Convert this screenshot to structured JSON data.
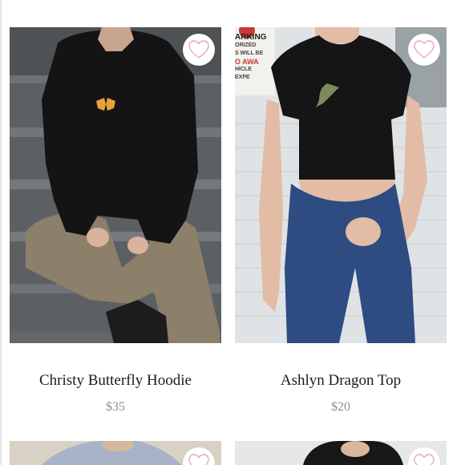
{
  "products": [
    {
      "name": "Christy Butterfly Hoodie",
      "price": "$35"
    },
    {
      "name": "Ashlyn Dragon Top",
      "price": "$20"
    }
  ],
  "partial_products_count_visible": 2,
  "icons": {
    "favorite": "heart-outline-icon"
  },
  "colors": {
    "heart": "#e8a9b3",
    "name_text": "#1b1b1b",
    "price_text": "#8e8e8e"
  },
  "sign_text": [
    "ARKING",
    "ORIZED",
    "S WILL BE",
    "O AWA",
    "HICLE",
    "EXPE"
  ]
}
